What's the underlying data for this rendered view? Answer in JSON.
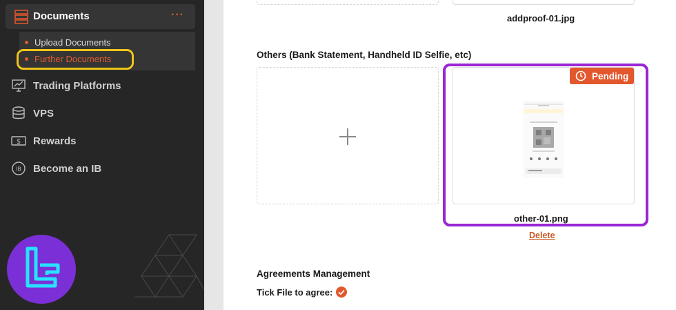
{
  "sidebar": {
    "documents": {
      "label": "Documents",
      "more": "···"
    },
    "sub_items": [
      {
        "label": "Upload Documents"
      },
      {
        "label": "Further Documents"
      }
    ],
    "items": [
      {
        "label": "Trading Platforms",
        "icon": "monitor-chart-icon"
      },
      {
        "label": "VPS",
        "icon": "database-icon"
      },
      {
        "label": "Rewards",
        "icon": "dollar-bill-icon"
      },
      {
        "label": "Become an IB",
        "icon": "ib-circle-icon"
      }
    ]
  },
  "main": {
    "top_file_name": "addproof-01.jpg",
    "others_title": "Others (Bank Statement, Handheld ID Selfie, etc)",
    "pending_label": "Pending",
    "other_file_name": "other-01.png",
    "delete_label": "Delete",
    "agreements_title": "Agreements Management",
    "tick_label": "Tick File to agree:"
  },
  "colors": {
    "accent": "#e2572c",
    "highlight_yellow": "#f0c419",
    "highlight_purple": "#9b26d4",
    "sidebar_bg": "#262626"
  }
}
